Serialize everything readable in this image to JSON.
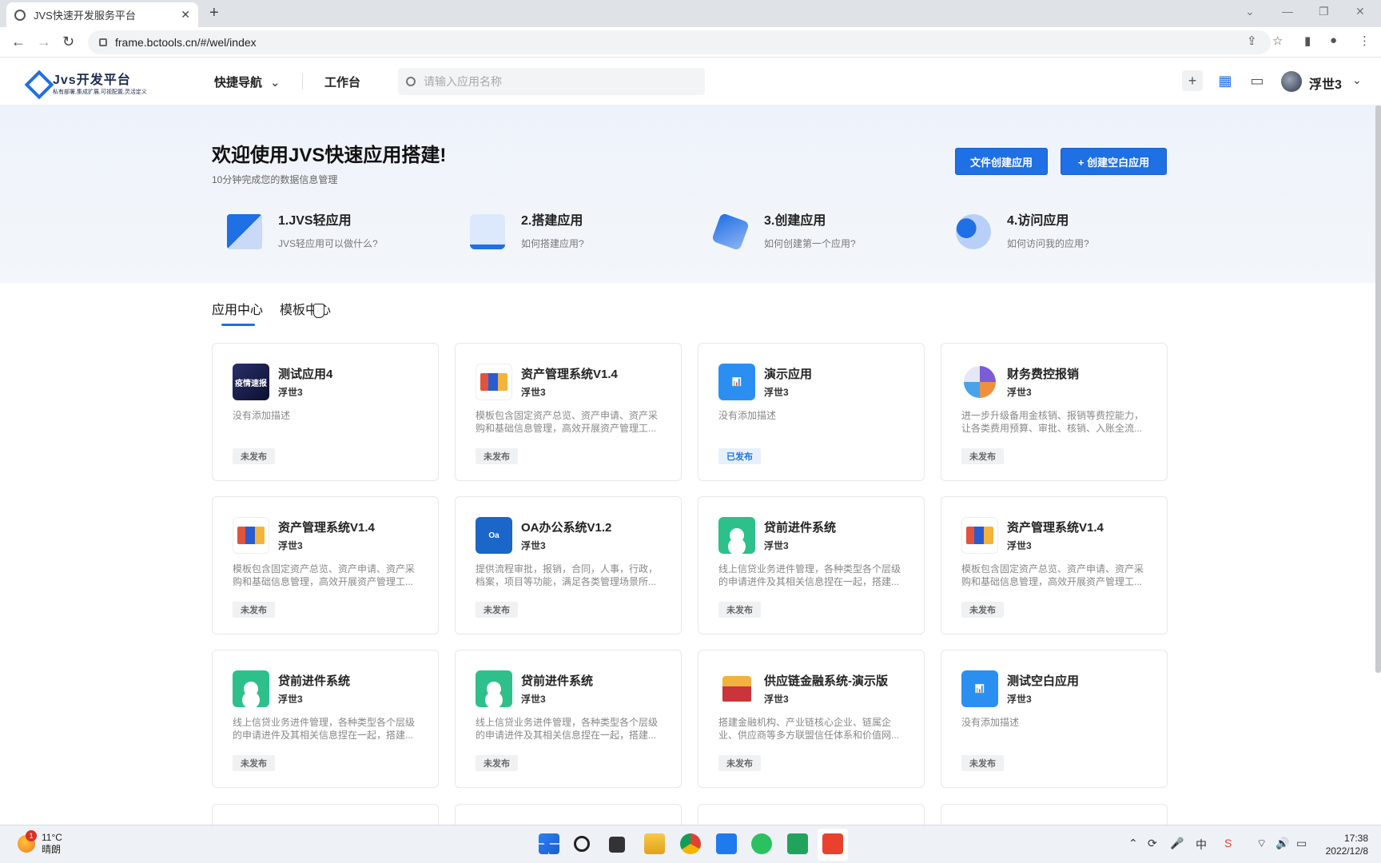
{
  "browser": {
    "tab_title": "JVS快速开发服务平台",
    "tab_close": "✕",
    "new_tab": "+",
    "url": "frame.bctools.cn/#/wel/index",
    "win_controls": [
      "⌄",
      "—",
      "❐",
      "✕"
    ]
  },
  "header": {
    "logo_title": "Jvs开发平台",
    "logo_tagline": "私有部署,集成扩展,可视配置,灵活定义",
    "nav_quick": "快捷导航",
    "nav_workbench": "工作台",
    "search_placeholder": "请输入应用名称",
    "username": "浮世3"
  },
  "hero": {
    "title": "欢迎使用JVS快速应用搭建!",
    "subtitle": "10分钟完成您的数据信息管理",
    "btn_file_create": "文件创建应用",
    "btn_blank_create": "+ 创建空白应用",
    "steps": [
      {
        "title": "1.JVS轻应用",
        "desc": "JVS轻应用可以做什么?"
      },
      {
        "title": "2.搭建应用",
        "desc": "如何搭建应用?"
      },
      {
        "title": "3.创建应用",
        "desc": "如何创建第一个应用?"
      },
      {
        "title": "4.访问应用",
        "desc": "如何访问我的应用?"
      }
    ]
  },
  "tabs": {
    "app_center": "应用中心",
    "template_center": "模板中心"
  },
  "apps": [
    {
      "name": "测试应用4",
      "owner": "浮世3",
      "desc": "没有添加描述",
      "status": "未发布",
      "icon_text": "疫情速报"
    },
    {
      "name": "资产管理系统V1.4",
      "owner": "浮世3",
      "desc": "模板包含固定资产总览、资产申请、资产采购和基础信息管理，高效开展资产管理工...",
      "status": "未发布"
    },
    {
      "name": "演示应用",
      "owner": "浮世3",
      "desc": "没有添加描述",
      "status": "已发布",
      "icon_text": "📊"
    },
    {
      "name": "财务费控报销",
      "owner": "浮世3",
      "desc": "进一步升级备用金核销、报销等费控能力，让各类费用预算、审批、核销、入账全流...",
      "status": "未发布"
    },
    {
      "name": "资产管理系统V1.4",
      "owner": "浮世3",
      "desc": "模板包含固定资产总览、资产申请、资产采购和基础信息管理，高效开展资产管理工...",
      "status": "未发布"
    },
    {
      "name": "OA办公系统V1.2",
      "owner": "浮世3",
      "desc": "提供流程审批，报销，合同，人事，行政，档案，项目等功能，满足各类管理场景所...",
      "status": "未发布",
      "icon_text": "Oa"
    },
    {
      "name": "贷前进件系统",
      "owner": "浮世3",
      "desc": "线上信贷业务进件管理，各种类型各个层级的申请进件及其相关信息捏在一起，搭建...",
      "status": "未发布"
    },
    {
      "name": "资产管理系统V1.4",
      "owner": "浮世3",
      "desc": "模板包含固定资产总览、资产申请、资产采购和基础信息管理，高效开展资产管理工...",
      "status": "未发布"
    },
    {
      "name": "贷前进件系统",
      "owner": "浮世3",
      "desc": "线上信贷业务进件管理，各种类型各个层级的申请进件及其相关信息捏在一起，搭建...",
      "status": "未发布"
    },
    {
      "name": "贷前进件系统",
      "owner": "浮世3",
      "desc": "线上信贷业务进件管理，各种类型各个层级的申请进件及其相关信息捏在一起，搭建...",
      "status": "未发布"
    },
    {
      "name": "供应链金融系统-演示版",
      "owner": "浮世3",
      "desc": "搭建金融机构、产业链核心企业、链属企业、供应商等多方联盟信任体系和价值网...",
      "status": "未发布"
    },
    {
      "name": "测试空白应用",
      "owner": "浮世3",
      "desc": "没有添加描述",
      "status": "未发布",
      "icon_text": "📊"
    }
  ],
  "taskbar": {
    "weather_temp": "11°C",
    "weather_desc": "晴朗",
    "weather_badge": "1",
    "ime": "中",
    "time": "17:38",
    "date": "2022/12/8"
  },
  "colors": {
    "accent": "#1f6fe5",
    "published": "#1f6fe5",
    "draft_bg": "#f0f1f3"
  }
}
